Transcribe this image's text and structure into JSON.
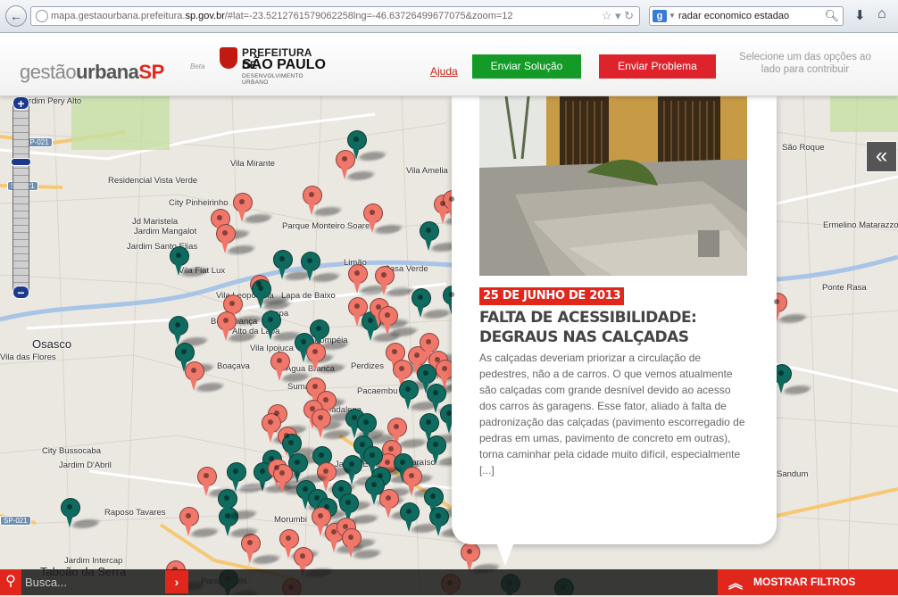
{
  "browser": {
    "url_prefix": "mapa.gestaourbana.prefeitura.",
    "url_host": "sp.gov.br",
    "url_rest": "/#lat=-23.5212761579062258lng=-46.63726499677075&zoom=12",
    "search_query": "radar economico estadao",
    "search_engine": "g"
  },
  "header": {
    "logo_part1": "gestão",
    "logo_part2": "urbana",
    "logo_part3": "SP",
    "logo_beta": "Beta",
    "pref_line1": "PREFEITURA DE",
    "pref_line2": "SÃO PAULO",
    "pref_line3": "DESENVOLVIMENTO URBANO",
    "help": "Ajuda",
    "btn_solution": "Enviar Solução",
    "btn_problem": "Enviar Problema",
    "hint": "Selecione um das opções ao lado para contribuir"
  },
  "map": {
    "labels": [
      "Jardim Pery Alto",
      "Vila Mirante",
      "Vila Amelia",
      "Residencial Vista Verde",
      "City Pinheirinho",
      "Jd Maristela",
      "Jardim Mangalot",
      "Jardim Santo Elias",
      "Parque Monteiro Soares",
      "Limão",
      "Casa Verde",
      "Vila Fiat Lux",
      "Vila Leopoldina",
      "Lapa de Baixo",
      "Bela Aliança",
      "Alto da Lapa",
      "Lapa",
      "Pompéia",
      "Osasco",
      "Vila Ipojuca",
      "Boaçava",
      "Água Branca",
      "Perdizes",
      "Sumaré",
      "Pacaembu",
      "Vila Madalena",
      "City Bussocaba",
      "Jardim D'Abril",
      "Jardim Europa",
      "Paraíso",
      "Raposo Tavares",
      "Morumbi",
      "Jardim Intercap",
      "Taboão da Serra",
      "Paraisópolis",
      "São Roque",
      "Ermelino Matarazzo",
      "Ponte Rasa",
      "Vila das Flores",
      "Sandum"
    ],
    "road_shields": [
      "SP-021",
      "SP-021",
      "SP-021"
    ],
    "zoom_in": "+",
    "zoom_out": "−",
    "expand": "«"
  },
  "card": {
    "date": "25 DE JUNHO DE 2013",
    "title": "FALTA DE ACESSIBILIDADE: DEGRAUS NAS CALÇADAS",
    "body": "As calçadas deveriam priorizar a circulação de pedestres, não a de carros. O que vemos atualmente são calçadas com grande desnível devido ao acesso dos carros às garagens. Esse fator, aliado à falta de padronização das calçadas (pavimento escorregadio de pedras em umas, pavimento de concreto em outras), torna caminhar pela cidade muito difícil, especialmente [...]"
  },
  "bottom": {
    "search_placeholder": "Busca...",
    "filters": "MOSTRAR FILTROS"
  },
  "colors": {
    "problem_pin": "#f1776a",
    "solution_pin": "#0f6b5f",
    "accent_red": "#e1261c",
    "accent_green": "#139a27"
  }
}
